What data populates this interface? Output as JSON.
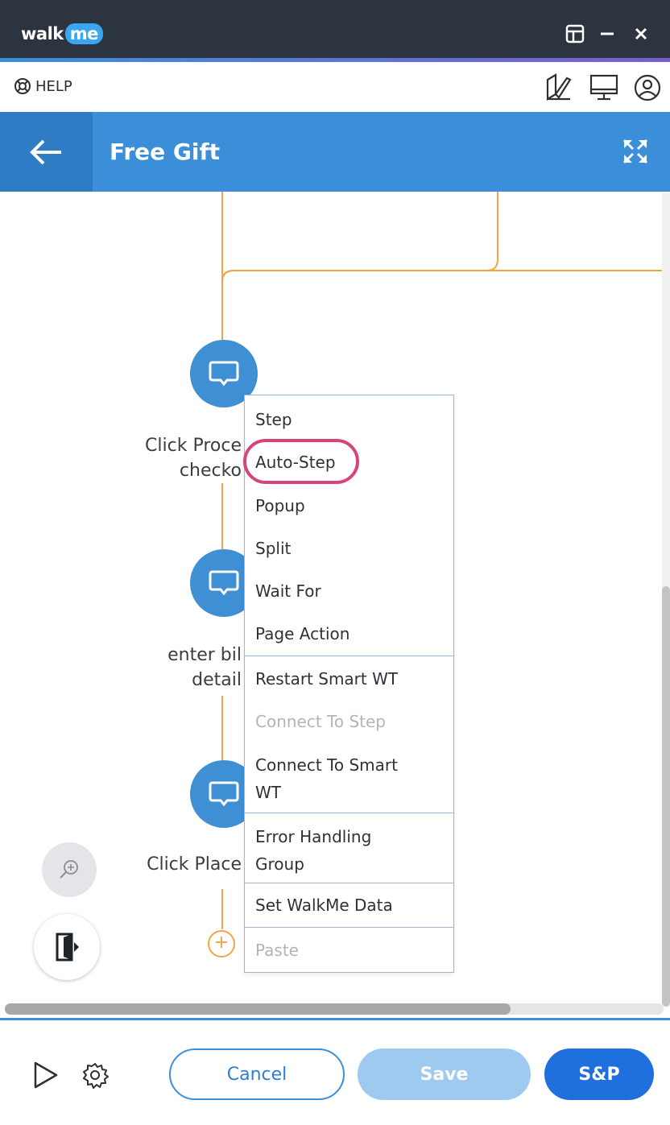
{
  "app": {
    "brand_prefix": "walk",
    "brand_suffix": "me"
  },
  "helpbar": {
    "help_label": "HELP"
  },
  "header": {
    "title": "Free Gift"
  },
  "nodes": [
    {
      "label_line1": "Click Proce",
      "label_line2": "checko"
    },
    {
      "label_line1": "enter bil",
      "label_line2": "detail"
    },
    {
      "label_line1": "Click Place",
      "label_line2": ""
    }
  ],
  "context_menu": {
    "items": [
      {
        "label": "Step"
      },
      {
        "label": "Auto-Step"
      },
      {
        "label": "Popup"
      },
      {
        "label": "Split"
      },
      {
        "label": "Wait For"
      },
      {
        "label": "Page Action"
      },
      {
        "label": "Restart Smart WT"
      },
      {
        "label": "Connect To Step"
      },
      {
        "label": "Connect To Smart",
        "label2": "WT"
      },
      {
        "label": "Error Handling",
        "label2": "Group"
      },
      {
        "label": "Set WalkMe Data"
      },
      {
        "label": "Paste"
      }
    ]
  },
  "footer": {
    "cancel_label": "Cancel",
    "save_label": "Save",
    "sp_label": "S&P"
  },
  "colors": {
    "header": "#3b8fd8",
    "accent": "#1f6fdc",
    "flow_line": "#f3a446",
    "highlight": "#d6447b"
  }
}
